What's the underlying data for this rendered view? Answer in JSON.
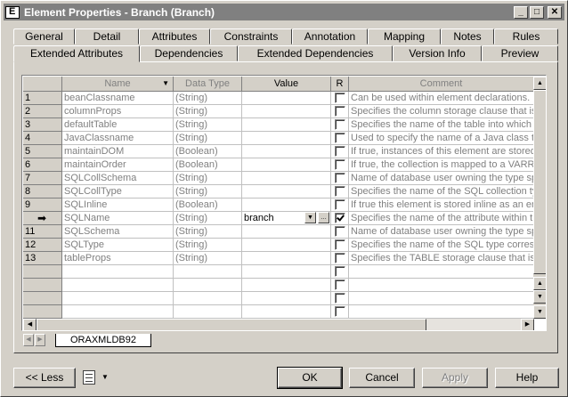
{
  "window": {
    "title": "Element Properties - Branch (Branch)"
  },
  "tabs_row1": [
    "General",
    "Detail",
    "Attributes",
    "Constraints",
    "Annotation",
    "Mapping",
    "Notes",
    "Rules"
  ],
  "tabs_row2": [
    "Extended Attributes",
    "Dependencies",
    "Extended Dependencies",
    "Version Info",
    "Preview"
  ],
  "active_tab": "Extended Attributes",
  "grid": {
    "columns": [
      "Name",
      "Data Type",
      "Value",
      "R",
      "Comment"
    ],
    "rows": [
      {
        "num": "1",
        "name": "beanClassname",
        "type": "(String)",
        "value": "",
        "r": false,
        "comment": "Can be used within element declarations. If"
      },
      {
        "num": "2",
        "name": "columnProps",
        "type": "(String)",
        "value": "",
        "r": false,
        "comment": "Specifies the column storage clause that is"
      },
      {
        "num": "3",
        "name": "defaultTable",
        "type": "(String)",
        "value": "",
        "r": false,
        "comment": "Specifies the name of the table into which X"
      },
      {
        "num": "4",
        "name": "JavaClassname",
        "type": "(String)",
        "value": "",
        "r": false,
        "comment": "Used to specify the name of a Java class th"
      },
      {
        "num": "5",
        "name": "maintainDOM",
        "type": "(Boolean)",
        "value": "",
        "r": false,
        "comment": "If true, instances of this element are stored"
      },
      {
        "num": "6",
        "name": "maintainOrder",
        "type": "(Boolean)",
        "value": "",
        "r": false,
        "comment": "If true, the collection is mapped to a VARRA"
      },
      {
        "num": "7",
        "name": "SQLCollSchema",
        "type": "(String)",
        "value": "",
        "r": false,
        "comment": "Name of database user owning the type sp"
      },
      {
        "num": "8",
        "name": "SQLCollType",
        "type": "(String)",
        "value": "",
        "r": false,
        "comment": "Specifies the name of the SQL collection ty"
      },
      {
        "num": "9",
        "name": "SQLInline",
        "type": "(Boolean)",
        "value": "",
        "r": false,
        "comment": "If true this element is stored inline as an em"
      },
      {
        "num": "",
        "name": "SQLName",
        "type": "(String)",
        "value": "branch",
        "r": true,
        "comment": "Specifies the name of the attribute within th",
        "current": true
      },
      {
        "num": "11",
        "name": "SQLSchema",
        "type": "(String)",
        "value": "",
        "r": false,
        "comment": "Name of database user owning the type sp"
      },
      {
        "num": "12",
        "name": "SQLType",
        "type": "(String)",
        "value": "",
        "r": false,
        "comment": "Specifies the name of the SQL type corresp"
      },
      {
        "num": "13",
        "name": "tableProps",
        "type": "(String)",
        "value": "",
        "r": false,
        "comment": "Specifies the TABLE storage clause that is"
      }
    ],
    "empty_rows": 5
  },
  "sheet_tab": "ORAXMLDB92",
  "buttons": {
    "less": "<< Less",
    "ok": "OK",
    "cancel": "Cancel",
    "apply": "Apply",
    "help": "Help"
  }
}
